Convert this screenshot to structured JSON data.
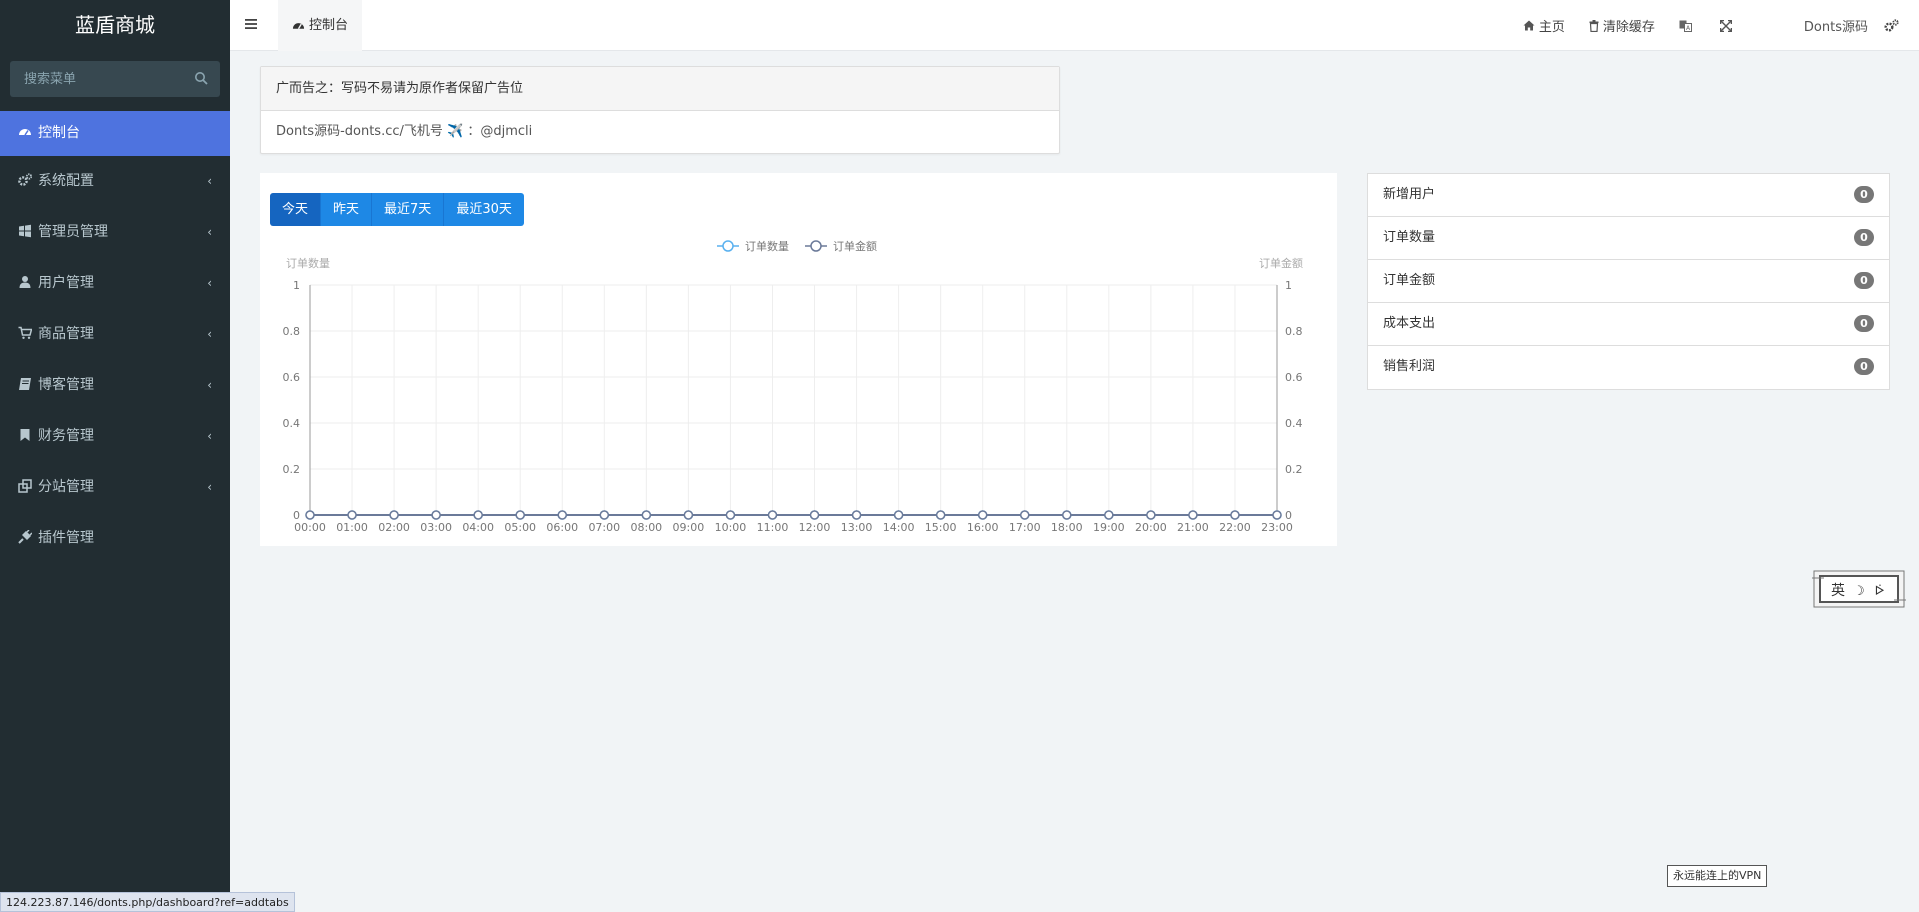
{
  "sidebar": {
    "logo": "蓝盾商城",
    "search_placeholder": "搜索菜单",
    "items": [
      {
        "label": "控制台",
        "icon": "dashboard-icon",
        "active": true
      },
      {
        "label": "系统配置",
        "icon": "cogs-icon"
      },
      {
        "label": "管理员管理",
        "icon": "windows-icon"
      },
      {
        "label": "用户管理",
        "icon": "user-icon"
      },
      {
        "label": "商品管理",
        "icon": "cart-icon"
      },
      {
        "label": "博客管理",
        "icon": "book-icon"
      },
      {
        "label": "财务管理",
        "icon": "bookmark-icon"
      },
      {
        "label": "分站管理",
        "icon": "clone-icon"
      },
      {
        "label": "插件管理",
        "icon": "plug-icon"
      }
    ],
    "chevron": "‹"
  },
  "header": {
    "tab_label": "控制台",
    "home_label": "主页",
    "clear_cache_label": "清除缓存",
    "user_name": "Donts源码"
  },
  "notice": {
    "title": "广而告之：写码不易请为原作者保留广告位",
    "body": "Donts源码-donts.cc/飞机号 ✈️ ：@djmcli"
  },
  "range_buttons": [
    "今天",
    "昨天",
    "最近7天",
    "最近30天"
  ],
  "chart_data": {
    "type": "line",
    "x": [
      "00:00",
      "01:00",
      "02:00",
      "03:00",
      "04:00",
      "05:00",
      "06:00",
      "07:00",
      "08:00",
      "09:00",
      "10:00",
      "11:00",
      "12:00",
      "13:00",
      "14:00",
      "15:00",
      "16:00",
      "17:00",
      "18:00",
      "19:00",
      "20:00",
      "21:00",
      "22:00",
      "23:00"
    ],
    "series": [
      {
        "name": "订单数量",
        "values": [
          0,
          0,
          0,
          0,
          0,
          0,
          0,
          0,
          0,
          0,
          0,
          0,
          0,
          0,
          0,
          0,
          0,
          0,
          0,
          0,
          0,
          0,
          0,
          0
        ],
        "color": "#5ab1ef"
      },
      {
        "name": "订单金额",
        "values": [
          0,
          0,
          0,
          0,
          0,
          0,
          0,
          0,
          0,
          0,
          0,
          0,
          0,
          0,
          0,
          0,
          0,
          0,
          0,
          0,
          0,
          0,
          0,
          0
        ],
        "color": "#6b7a99"
      }
    ],
    "ylabel_left": "订单数量",
    "ylabel_right": "订单金额",
    "ylim": [
      0,
      1
    ],
    "yticks": [
      "0",
      "0.2",
      "0.4",
      "0.6",
      "0.8",
      "1"
    ],
    "legend": "top-center",
    "grid": true
  },
  "stats": [
    {
      "label": "新增用户",
      "value": "0"
    },
    {
      "label": "订单数量",
      "value": "0"
    },
    {
      "label": "订单金额",
      "value": "0"
    },
    {
      "label": "成本支出",
      "value": "0"
    },
    {
      "label": "销售利润",
      "value": "0"
    }
  ],
  "stamp_text": [
    "英",
    "☽",
    "ᢰ"
  ],
  "vpn_tip": "永远能连上的VPN",
  "status_url": "124.223.87.146/donts.php/dashboard?ref=addtabs"
}
